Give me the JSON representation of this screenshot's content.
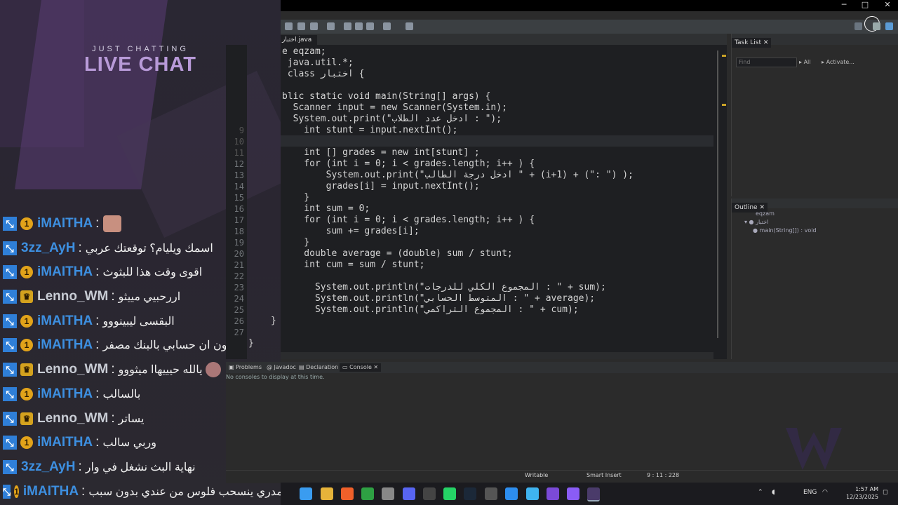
{
  "overlay": {
    "subtitle": "JUST CHATTING",
    "title": "LIVE CHAT",
    "messages": [
      {
        "user": "iMAITHA",
        "badge": "1",
        "text": ""
      },
      {
        "user": "3zz_AyH",
        "badge": "",
        "text": "اسمك ويليام؟ توقعتك عربي"
      },
      {
        "user": "iMAITHA",
        "badge": "1",
        "text": "اقوى وقت هذا للبثوث"
      },
      {
        "user": "Lenno_WM",
        "badge": "crown",
        "text": "اررحبيي مييثو"
      },
      {
        "user": "iMAITHA",
        "badge": "1",
        "text": "البقسى ليبينووو"
      },
      {
        "user": "iMAITHA",
        "badge": "1",
        "text": "تدرون ان حسابي بالبنك مصفر"
      },
      {
        "user": "Lenno_WM",
        "badge": "crown",
        "text": "يالله حيييهاا ميثووو"
      },
      {
        "user": "iMAITHA",
        "badge": "1",
        "text": "بالسالب"
      },
      {
        "user": "Lenno_WM",
        "badge": "crown",
        "text": "يساتر"
      },
      {
        "user": "iMAITHA",
        "badge": "1",
        "text": "وربي سالب"
      },
      {
        "user": "3zz_AyH",
        "badge": "",
        "text": "نهاية البث نشغل في وار"
      },
      {
        "user": "iMAITHA",
        "badge": "1",
        "text": "مدري ينسحب فلوس من عندي بدون سبب"
      }
    ]
  },
  "editor": {
    "tab_label": "اختبار.java",
    "lines": {
      "l1": "e eqzam;",
      "l2": " java.util.*;",
      "l3": " class اختبار {",
      "l5": "blic static void main(String[] args) {",
      "l6": "  Scanner input = new Scanner(System.in);",
      "l7": "  System.out.print(\"ادخل عدد الطلاب : \");",
      "l8": "    int stunt = input.nextInt();",
      "l10": "    int [] grades = new int[stunt] ;",
      "l11": "    for (int i = 0; i < grades.length; i++ ) {",
      "l12": "        System.out.print(\"ادخل درجة الطالب \" + (i+1) + (\": \") );",
      "l13": "        grades[i] = input.nextInt();",
      "l14": "    }",
      "l15": "    int sum = 0;",
      "l16": "    for (int i = 0; i < grades.length; i++ ) {",
      "l17": "        sum += grades[i];",
      "l18": "    }",
      "l19": "    double average = (double) sum / stunt;",
      "l20": "    int cum = sum / stunt;",
      "l22": "      System.out.println(\"المجموع الكلي للدرجات : \" + sum);",
      "l23": "      System.out.println(\"المتوسط الحسابي : \" + average);",
      "l24": "      System.out.println(\"المجموع التراكمي : \" + cum);",
      "l25": "}",
      "l27": "}"
    },
    "line_numbers": [
      "9",
      "10",
      "11",
      "12",
      "13",
      "14",
      "15",
      "16",
      "17",
      "18",
      "19",
      "20",
      "21",
      "22",
      "23",
      "24",
      "25",
      "26",
      "27"
    ]
  },
  "tasklist": {
    "tab": "Task List",
    "find_placeholder": "Find",
    "all": "All",
    "activate": "Activate..."
  },
  "outline": {
    "tab": "Outline",
    "package": "eqzam",
    "class": "اختبار",
    "method": "main(String[]) : void"
  },
  "console": {
    "tabs": [
      "Problems",
      "Javadoc",
      "Declaration",
      "Console"
    ],
    "message": "No consoles to display at this time."
  },
  "status": {
    "writable": "Writable",
    "insert": "Smart Insert",
    "position": "9 : 11 : 228"
  },
  "taskbar": {
    "lang": "ENG",
    "time": "1:57 AM",
    "date": "12/23/2025"
  }
}
